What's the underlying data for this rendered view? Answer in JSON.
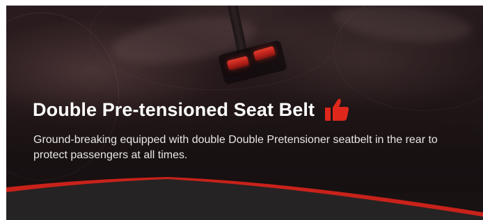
{
  "banner": {
    "headline": "Double Pre-tensioned Seat Belt",
    "description": "Ground-breaking equipped with double Double Pretensioner seatbelt in the rear to protect passengers at all times.",
    "headline_icon": "thumbs-up-icon",
    "accent_color": "#e0271c",
    "text_color": "#ffffff"
  }
}
